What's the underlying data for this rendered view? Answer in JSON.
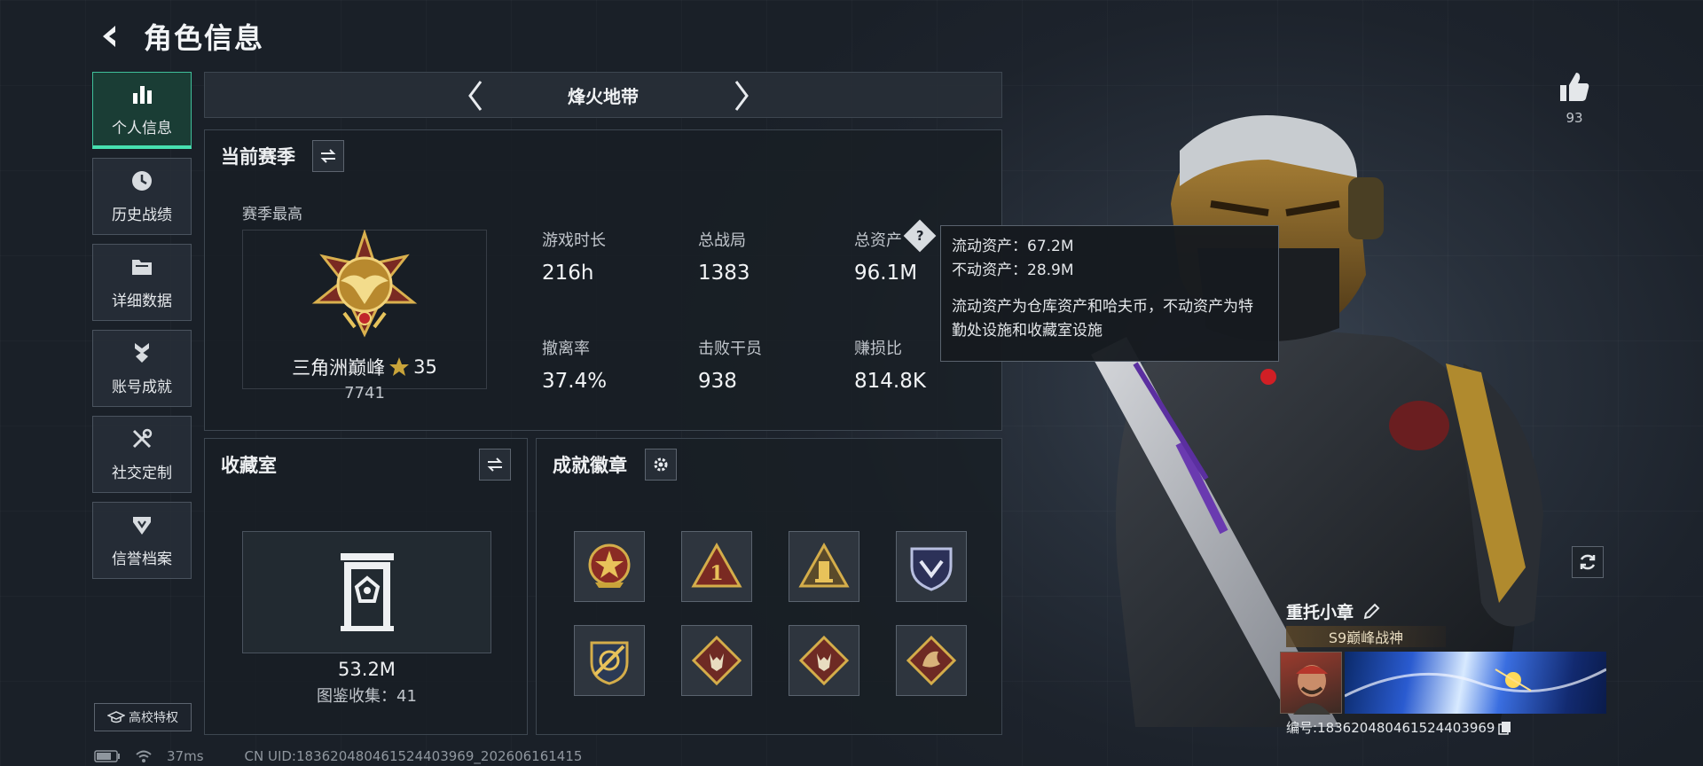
{
  "header": {
    "title": "角色信息"
  },
  "sidebar": {
    "items": [
      {
        "label": "个人信息",
        "icon": "bar-chart-icon",
        "active": true
      },
      {
        "label": "历史战绩",
        "icon": "clock-icon"
      },
      {
        "label": "详细数据",
        "icon": "folder-icon"
      },
      {
        "label": "账号成就",
        "icon": "medal-icon"
      },
      {
        "label": "社交定制",
        "icon": "wrench-icon"
      },
      {
        "label": "信誉档案",
        "icon": "shield-icon"
      }
    ],
    "campus_label": "高校特权"
  },
  "mode_bar": {
    "title": "烽火地带"
  },
  "season": {
    "title": "当前赛季",
    "best_label": "赛季最高",
    "rank_name": "三角洲巅峰",
    "rank_stars": "35",
    "rank_score": "7741",
    "stats": [
      {
        "label": "游戏时长",
        "value": "216h"
      },
      {
        "label": "总战局",
        "value": "1383"
      },
      {
        "label": "总资产",
        "value": "96.1M"
      },
      {
        "label": "撤离率",
        "value": "37.4%"
      },
      {
        "label": "击败干员",
        "value": "938"
      },
      {
        "label": "赚损比",
        "value": "814.8K"
      }
    ]
  },
  "tooltip": {
    "liquid": "流动资产：67.2M",
    "fixed": "不动资产：28.9M",
    "desc": "流动资产为仓库资产和哈夫币，不动资产为特勤处设施和收藏室设施"
  },
  "collection": {
    "title": "收藏室",
    "value": "53.2M",
    "count_label": "图鉴收集：41"
  },
  "achievements": {
    "title": "成就徽章",
    "badges": [
      "star-emblem-badge",
      "rank-one-badge",
      "tower-badge",
      "shield-badge",
      "wings-badge",
      "wolf-badge",
      "wolf-badge",
      "dragon-badge"
    ]
  },
  "profile": {
    "likes": "93",
    "name": "重托小章",
    "title_badge": "S9巅峰战神",
    "uid_label": "编号:18362048046152440396​9"
  },
  "footer": {
    "ping": "37ms",
    "uid": "CN UID:18362048046152440396​9_202606161415"
  },
  "colors": {
    "accent": "#47e0b0",
    "gold": "#c9a43a",
    "panel": "#181e25"
  }
}
